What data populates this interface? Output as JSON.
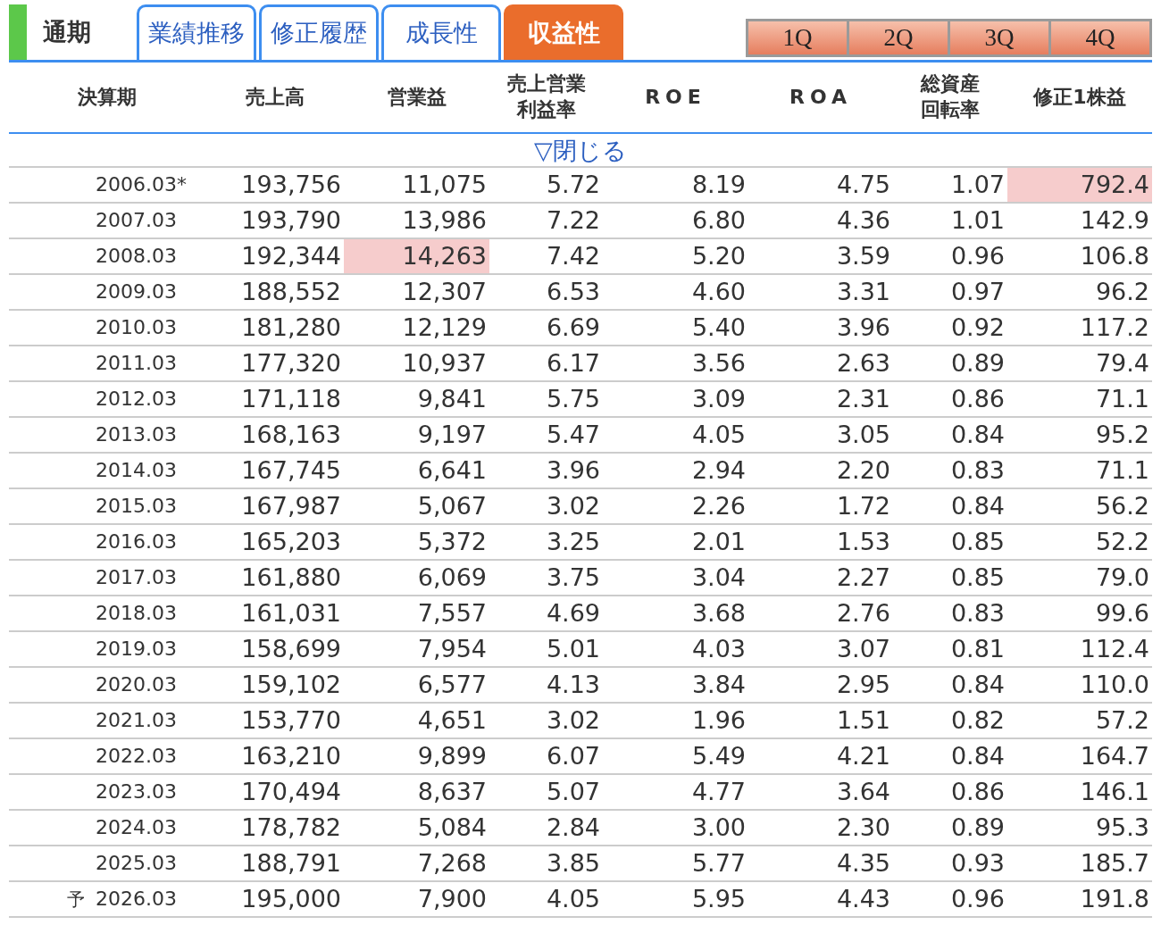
{
  "tabs": [
    {
      "kind": "label",
      "label": "通期"
    },
    {
      "kind": "tab",
      "label": "業績推移",
      "selected": false
    },
    {
      "kind": "tab",
      "label": "修正履歴",
      "selected": false
    },
    {
      "kind": "tab",
      "label": "成長性",
      "selected": false
    },
    {
      "kind": "tab",
      "label": "収益性",
      "selected": true
    }
  ],
  "quarter_buttons": [
    "1Q",
    "2Q",
    "3Q",
    "4Q"
  ],
  "columns": [
    "決算期",
    "売上高",
    "営業益",
    "売上営業利益率",
    "ROE",
    "ROA",
    "総資産回転率",
    "修正1株益"
  ],
  "toggle": "▽閉じる",
  "rows": [
    {
      "prefix": "",
      "period": "2006.03*",
      "values": [
        "193,756",
        "11,075",
        "5.72",
        "8.19",
        "4.75",
        "1.07",
        "792.4"
      ],
      "highlights": [
        false,
        false,
        false,
        false,
        false,
        false,
        true
      ]
    },
    {
      "prefix": "",
      "period": "2007.03",
      "values": [
        "193,790",
        "13,986",
        "7.22",
        "6.80",
        "4.36",
        "1.01",
        "142.9"
      ],
      "highlights": [
        false,
        false,
        false,
        false,
        false,
        false,
        false
      ]
    },
    {
      "prefix": "",
      "period": "2008.03",
      "values": [
        "192,344",
        "14,263",
        "7.42",
        "5.20",
        "3.59",
        "0.96",
        "106.8"
      ],
      "highlights": [
        false,
        true,
        false,
        false,
        false,
        false,
        false
      ]
    },
    {
      "prefix": "",
      "period": "2009.03",
      "values": [
        "188,552",
        "12,307",
        "6.53",
        "4.60",
        "3.31",
        "0.97",
        "96.2"
      ],
      "highlights": [
        false,
        false,
        false,
        false,
        false,
        false,
        false
      ]
    },
    {
      "prefix": "",
      "period": "2010.03",
      "values": [
        "181,280",
        "12,129",
        "6.69",
        "5.40",
        "3.96",
        "0.92",
        "117.2"
      ],
      "highlights": [
        false,
        false,
        false,
        false,
        false,
        false,
        false
      ]
    },
    {
      "prefix": "",
      "period": "2011.03",
      "values": [
        "177,320",
        "10,937",
        "6.17",
        "3.56",
        "2.63",
        "0.89",
        "79.4"
      ],
      "highlights": [
        false,
        false,
        false,
        false,
        false,
        false,
        false
      ]
    },
    {
      "prefix": "",
      "period": "2012.03",
      "values": [
        "171,118",
        "9,841",
        "5.75",
        "3.09",
        "2.31",
        "0.86",
        "71.1"
      ],
      "highlights": [
        false,
        false,
        false,
        false,
        false,
        false,
        false
      ]
    },
    {
      "prefix": "",
      "period": "2013.03",
      "values": [
        "168,163",
        "9,197",
        "5.47",
        "4.05",
        "3.05",
        "0.84",
        "95.2"
      ],
      "highlights": [
        false,
        false,
        false,
        false,
        false,
        false,
        false
      ]
    },
    {
      "prefix": "",
      "period": "2014.03",
      "values": [
        "167,745",
        "6,641",
        "3.96",
        "2.94",
        "2.20",
        "0.83",
        "71.1"
      ],
      "highlights": [
        false,
        false,
        false,
        false,
        false,
        false,
        false
      ]
    },
    {
      "prefix": "",
      "period": "2015.03",
      "values": [
        "167,987",
        "5,067",
        "3.02",
        "2.26",
        "1.72",
        "0.84",
        "56.2"
      ],
      "highlights": [
        false,
        false,
        false,
        false,
        false,
        false,
        false
      ]
    },
    {
      "prefix": "",
      "period": "2016.03",
      "values": [
        "165,203",
        "5,372",
        "3.25",
        "2.01",
        "1.53",
        "0.85",
        "52.2"
      ],
      "highlights": [
        false,
        false,
        false,
        false,
        false,
        false,
        false
      ]
    },
    {
      "prefix": "",
      "period": "2017.03",
      "values": [
        "161,880",
        "6,069",
        "3.75",
        "3.04",
        "2.27",
        "0.85",
        "79.0"
      ],
      "highlights": [
        false,
        false,
        false,
        false,
        false,
        false,
        false
      ]
    },
    {
      "prefix": "",
      "period": "2018.03",
      "values": [
        "161,031",
        "7,557",
        "4.69",
        "3.68",
        "2.76",
        "0.83",
        "99.6"
      ],
      "highlights": [
        false,
        false,
        false,
        false,
        false,
        false,
        false
      ]
    },
    {
      "prefix": "",
      "period": "2019.03",
      "values": [
        "158,699",
        "7,954",
        "5.01",
        "4.03",
        "3.07",
        "0.81",
        "112.4"
      ],
      "highlights": [
        false,
        false,
        false,
        false,
        false,
        false,
        false
      ]
    },
    {
      "prefix": "",
      "period": "2020.03",
      "values": [
        "159,102",
        "6,577",
        "4.13",
        "3.84",
        "2.95",
        "0.84",
        "110.0"
      ],
      "highlights": [
        false,
        false,
        false,
        false,
        false,
        false,
        false
      ]
    },
    {
      "prefix": "",
      "period": "2021.03",
      "values": [
        "153,770",
        "4,651",
        "3.02",
        "1.96",
        "1.51",
        "0.82",
        "57.2"
      ],
      "highlights": [
        false,
        false,
        false,
        false,
        false,
        false,
        false
      ]
    },
    {
      "prefix": "",
      "period": "2022.03",
      "values": [
        "163,210",
        "9,899",
        "6.07",
        "5.49",
        "4.21",
        "0.84",
        "164.7"
      ],
      "highlights": [
        false,
        false,
        false,
        false,
        false,
        false,
        false
      ]
    },
    {
      "prefix": "",
      "period": "2023.03",
      "values": [
        "170,494",
        "8,637",
        "5.07",
        "4.77",
        "3.64",
        "0.86",
        "146.1"
      ],
      "highlights": [
        false,
        false,
        false,
        false,
        false,
        false,
        false
      ]
    },
    {
      "prefix": "",
      "period": "2024.03",
      "values": [
        "178,782",
        "5,084",
        "2.84",
        "3.00",
        "2.30",
        "0.89",
        "95.3"
      ],
      "highlights": [
        false,
        false,
        false,
        false,
        false,
        false,
        false
      ]
    },
    {
      "prefix": "",
      "period": "2025.03",
      "values": [
        "188,791",
        "7,268",
        "3.85",
        "5.77",
        "4.35",
        "0.93",
        "185.7"
      ],
      "highlights": [
        false,
        false,
        false,
        false,
        false,
        false,
        false
      ]
    },
    {
      "prefix": "予",
      "period": "2026.03",
      "values": [
        "195,000",
        "7,900",
        "4.05",
        "5.95",
        "4.43",
        "0.96",
        "191.8"
      ],
      "highlights": [
        false,
        false,
        false,
        false,
        false,
        false,
        false
      ]
    }
  ]
}
